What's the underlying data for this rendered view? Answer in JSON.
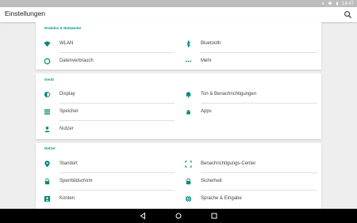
{
  "status": {
    "time": "14:47"
  },
  "appbar": {
    "title": "Einstellungen",
    "search_icon": "search-icon"
  },
  "colors": {
    "accent": "#009688",
    "icon": "#00897b",
    "statusbar": "#bdbdbd",
    "background": "#eeeeee"
  },
  "sections": [
    {
      "header": "Drahtlos & Netzwerke",
      "left": [
        {
          "label": "WLAN",
          "icon": "wifi-icon"
        },
        {
          "label": "Datenverbrauch",
          "icon": "data-usage-icon"
        }
      ],
      "right": [
        {
          "label": "Bluetooth",
          "icon": "bluetooth-icon"
        },
        {
          "label": "Mehr",
          "icon": "more-icon"
        }
      ]
    },
    {
      "header": "Gerät",
      "left": [
        {
          "label": "Display",
          "icon": "brightness-icon"
        },
        {
          "label": "Speicher",
          "icon": "storage-icon"
        },
        {
          "label": "Nutzer",
          "icon": "person-icon"
        }
      ],
      "right": [
        {
          "label": "Ton & Benachrichtigungen",
          "icon": "bell-icon"
        },
        {
          "label": "Apps",
          "icon": "android-icon"
        }
      ]
    },
    {
      "header": "Nutzer",
      "left": [
        {
          "label": "Standort",
          "icon": "location-icon"
        },
        {
          "label": "Sperrbildschirm",
          "icon": "lock-icon"
        },
        {
          "label": "Konten",
          "icon": "account-box-icon"
        }
      ],
      "right": [
        {
          "label": "Benachrichtigungs-Center",
          "icon": "notification-center-icon"
        },
        {
          "label": "Sicherheit",
          "icon": "security-lock-icon"
        },
        {
          "label": "Sprache & Eingabe",
          "icon": "language-icon"
        }
      ]
    }
  ],
  "navbar": {
    "back": "back-icon",
    "home": "home-icon",
    "recents": "recents-icon"
  }
}
